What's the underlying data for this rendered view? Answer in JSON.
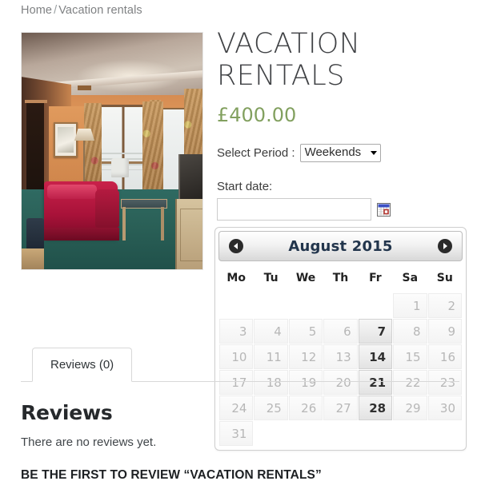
{
  "breadcrumb": {
    "home": "Home",
    "separator": "/",
    "current": "Vacation rentals"
  },
  "product": {
    "title": "VACATION RENTALS",
    "price": "£400.00",
    "image_alt": "hotel-room-photo"
  },
  "form": {
    "period_label": "Select Period :",
    "period_value": "Weekends",
    "period_options": [
      "Weekends"
    ],
    "start_date_label": "Start date:",
    "start_date_value": "",
    "start_date_placeholder": "",
    "calendar_icon": "calendar-icon"
  },
  "datepicker": {
    "prev_icon": "chevron-left-icon",
    "next_icon": "chevron-right-icon",
    "month_year": "August 2015",
    "day_headers": [
      "Mo",
      "Tu",
      "We",
      "Th",
      "Fr",
      "Sa",
      "Su"
    ],
    "weeks": [
      [
        {
          "day": "",
          "state": "empty"
        },
        {
          "day": "",
          "state": "empty"
        },
        {
          "day": "",
          "state": "empty"
        },
        {
          "day": "",
          "state": "empty"
        },
        {
          "day": "",
          "state": "empty"
        },
        {
          "day": "1",
          "state": "disabled"
        },
        {
          "day": "2",
          "state": "disabled"
        }
      ],
      [
        {
          "day": "3",
          "state": "disabled"
        },
        {
          "day": "4",
          "state": "disabled"
        },
        {
          "day": "5",
          "state": "disabled"
        },
        {
          "day": "6",
          "state": "disabled"
        },
        {
          "day": "7",
          "state": "enabled"
        },
        {
          "day": "8",
          "state": "disabled"
        },
        {
          "day": "9",
          "state": "disabled"
        }
      ],
      [
        {
          "day": "10",
          "state": "disabled"
        },
        {
          "day": "11",
          "state": "disabled"
        },
        {
          "day": "12",
          "state": "disabled"
        },
        {
          "day": "13",
          "state": "disabled"
        },
        {
          "day": "14",
          "state": "enabled"
        },
        {
          "day": "15",
          "state": "disabled"
        },
        {
          "day": "16",
          "state": "disabled"
        }
      ],
      [
        {
          "day": "17",
          "state": "disabled"
        },
        {
          "day": "18",
          "state": "disabled"
        },
        {
          "day": "19",
          "state": "disabled"
        },
        {
          "day": "20",
          "state": "disabled"
        },
        {
          "day": "21",
          "state": "enabled"
        },
        {
          "day": "22",
          "state": "disabled"
        },
        {
          "day": "23",
          "state": "disabled"
        }
      ],
      [
        {
          "day": "24",
          "state": "disabled"
        },
        {
          "day": "25",
          "state": "disabled"
        },
        {
          "day": "26",
          "state": "disabled"
        },
        {
          "day": "27",
          "state": "disabled"
        },
        {
          "day": "28",
          "state": "enabled"
        },
        {
          "day": "29",
          "state": "disabled"
        },
        {
          "day": "30",
          "state": "disabled"
        }
      ],
      [
        {
          "day": "31",
          "state": "disabled"
        },
        {
          "day": "",
          "state": "empty"
        },
        {
          "day": "",
          "state": "empty"
        },
        {
          "day": "",
          "state": "empty"
        },
        {
          "day": "",
          "state": "empty"
        },
        {
          "day": "",
          "state": "empty"
        },
        {
          "day": "",
          "state": "empty"
        }
      ]
    ]
  },
  "tabs": [
    {
      "label": "Reviews (0)",
      "active": true
    }
  ],
  "reviews": {
    "heading": "Reviews",
    "empty_text": "There are no reviews yet.",
    "be_first": "BE THE FIRST TO REVIEW “VACATION RENTALS”"
  },
  "colors": {
    "price_green": "#82a05f",
    "datepicker_title": "#22354c",
    "breadcrumb_gray": "#7f8183",
    "border_gray": "#d8d8d8"
  }
}
